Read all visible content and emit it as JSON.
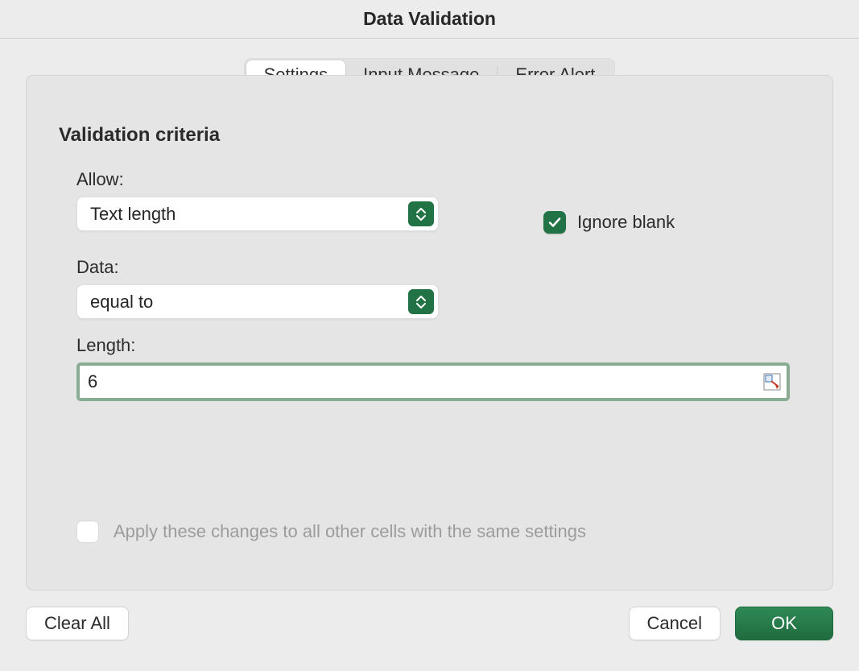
{
  "dialog": {
    "title": "Data Validation"
  },
  "tabs": {
    "settings": "Settings",
    "input_message": "Input Message",
    "error_alert": "Error Alert"
  },
  "panel": {
    "heading": "Validation criteria",
    "allow_label": "Allow:",
    "allow_value": "Text length",
    "data_label": "Data:",
    "data_value": "equal to",
    "length_label": "Length:",
    "length_value": "6",
    "ignore_blank_label": "Ignore blank",
    "ignore_blank_checked": true,
    "apply_all_label": "Apply these changes to all other cells with the same settings",
    "apply_all_checked": false
  },
  "buttons": {
    "clear_all": "Clear All",
    "cancel": "Cancel",
    "ok": "OK"
  },
  "colors": {
    "accent": "#217346"
  }
}
